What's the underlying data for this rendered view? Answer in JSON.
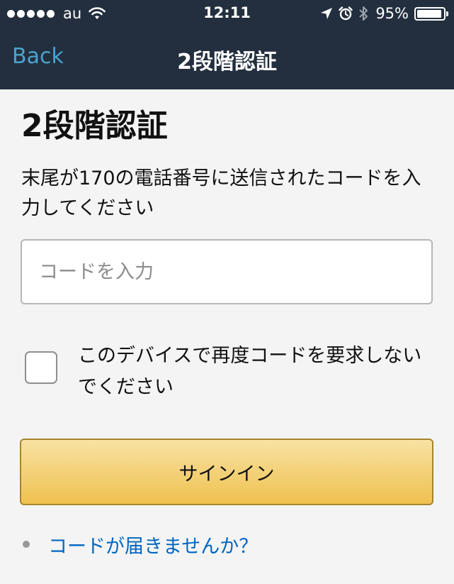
{
  "status_bar": {
    "carrier": "au",
    "time": "12:11",
    "battery_percent": "95%",
    "battery_level": 0.95,
    "icons": [
      "signal-dots-icon",
      "wifi-icon",
      "location-arrow-icon",
      "alarm-clock-icon",
      "bluetooth-icon",
      "battery-icon"
    ]
  },
  "nav": {
    "back_label": "Back",
    "title": "2段階認証"
  },
  "main": {
    "heading": "2段階認証",
    "instruction": "末尾が170の電話番号に送信されたコードを入力してください",
    "code_input": {
      "placeholder": "コードを入力",
      "value": ""
    },
    "remember_device": {
      "label": "このデバイスで再度コードを要求しないでください",
      "checked": false
    },
    "signin_label": "サインイン",
    "help_link": "コードが届きませんか？"
  },
  "colors": {
    "header_bg": "#232f3e",
    "back_link": "#4aa3cf",
    "button_top": "#f8e2a4",
    "button_bottom": "#efc14f",
    "link": "#0066c0",
    "page_bg": "#f4f4f4"
  }
}
